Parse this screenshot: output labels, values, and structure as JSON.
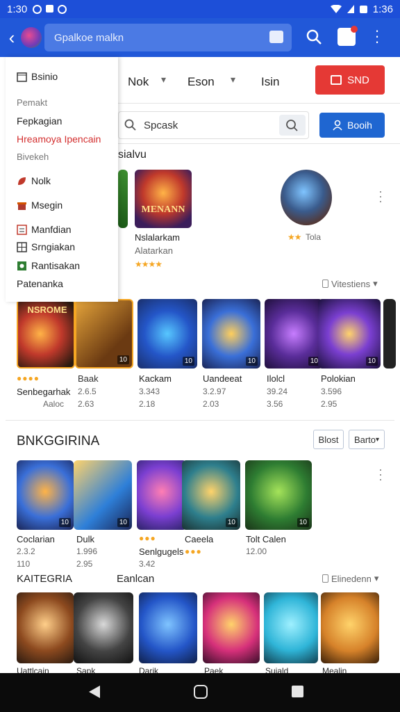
{
  "status_bar": {
    "left_time": "1:30",
    "right_time": "1:36"
  },
  "app_bar": {
    "search_text": "Gpalkoe malkn"
  },
  "drawer": {
    "items": [
      {
        "label": "Bsinio",
        "style": "bold"
      },
      {
        "label": "Pemakt",
        "style": "muted"
      },
      {
        "label": "Fepkagian",
        "style": "normal"
      },
      {
        "label": "Hreamoya Ipencain",
        "style": "red"
      },
      {
        "label": "Bivekeh",
        "style": "muted"
      },
      {
        "label": "Nolk",
        "style": "normal"
      },
      {
        "label": "Msegin",
        "style": "normal"
      },
      {
        "label": "Manfdian",
        "style": "normal"
      },
      {
        "label": "Srngiakan",
        "style": "normal"
      },
      {
        "label": "Rantisakan",
        "style": "normal"
      },
      {
        "label": "Patenanka",
        "style": "normal"
      }
    ]
  },
  "filters": {
    "f1": "Nok",
    "f2": "Eson",
    "f3": "Isin",
    "send_label": "SND"
  },
  "search": {
    "placeholder": "Spcask",
    "button_label": "Booih"
  },
  "section1": {
    "title": "sialvu",
    "items": [
      {
        "title": "Nslalarkam",
        "sub": "Alatarkan",
        "stars": "★★★★"
      },
      {
        "title": "",
        "sub": "Tola",
        "stars": "★★"
      }
    ],
    "see_all": "Vitestiens"
  },
  "row2": {
    "items": [
      {
        "title": "Senbegarhak",
        "sub1": "Baak",
        "sub2": "2.63",
        "num": "10",
        "thumb_text": "NSROME"
      },
      {
        "title": "Kackam",
        "sub1": "3.343",
        "sub2": "2.18",
        "num": "10",
        "thumb_text": ""
      },
      {
        "title": "Uandeeat",
        "sub1": "3.2.97",
        "sub2": "2.03",
        "num": "10",
        "thumb_text": ""
      },
      {
        "title": "Ilolcl",
        "sub1": "39.24",
        "sub2": "3.56",
        "num": "10",
        "thumb_text": ""
      },
      {
        "title": "Polokian",
        "sub1": "3.596",
        "sub2": "2.95",
        "num": "10",
        "thumb_text": ""
      }
    ],
    "extra": {
      "sub1": "2.6.5",
      "sub2": "Aaloc"
    }
  },
  "section2": {
    "title": "BNKGGIRINA",
    "btn1": "Blost",
    "btn2": "Barto",
    "items": [
      {
        "title": "Coclarian",
        "sub1": "2.3.2",
        "sub2": "110",
        "num": "10"
      },
      {
        "title": "Dulk",
        "sub1": "1.996",
        "sub2": "2.95",
        "num": "10"
      },
      {
        "title": "Senlgugels",
        "sub1": "",
        "sub2": "3.42",
        "num": "10"
      },
      {
        "title": "Caeela",
        "sub1": "",
        "sub2": "",
        "num": "10"
      },
      {
        "title": "Tolt Calen",
        "sub1": "12.00",
        "sub2": "",
        "num": "10"
      }
    ]
  },
  "section3": {
    "title": "KAITEGRIA",
    "title2": "Eanlcan",
    "see_all": "Elinedenn",
    "items": [
      {
        "title": "Uattlcain"
      },
      {
        "title": "Sapk"
      },
      {
        "title": "Darik"
      },
      {
        "title": "Paek"
      },
      {
        "title": "Suiald"
      },
      {
        "title": "Mealin"
      }
    ]
  },
  "colors": {
    "primary": "#2158d8",
    "accent_red": "#e53935",
    "button_blue": "#1f66d1",
    "star": "#f5a623"
  }
}
